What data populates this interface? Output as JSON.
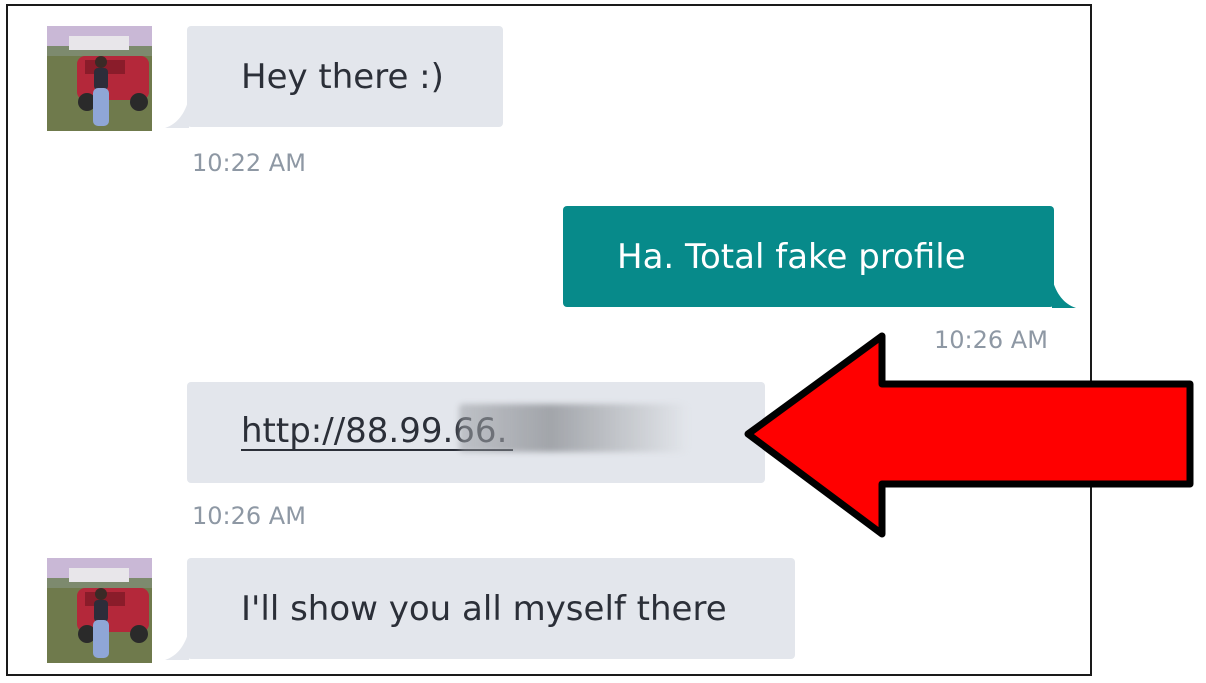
{
  "conversation": {
    "messages": [
      {
        "direction": "incoming",
        "text": "Hey there :)",
        "time": "10:22 AM",
        "avatar": "profile-photo"
      },
      {
        "direction": "outgoing",
        "text": "Ha.  Total fake profile",
        "time": "10:26 AM"
      },
      {
        "direction": "incoming",
        "text": "http://88.99.66.",
        "time": "10:26 AM",
        "is_link": true,
        "redacted": true
      },
      {
        "direction": "incoming",
        "text": "I'll show you all myself there",
        "avatar": "profile-photo"
      }
    ]
  },
  "annotation": {
    "type": "arrow",
    "color": "#ff0000",
    "outline": "#000000",
    "points_to": "link-message"
  },
  "colors": {
    "incoming_bubble": "#e3e6ec",
    "outgoing_bubble": "#078a8a",
    "timestamp": "#8e98a4",
    "text": "#2b2f38"
  }
}
